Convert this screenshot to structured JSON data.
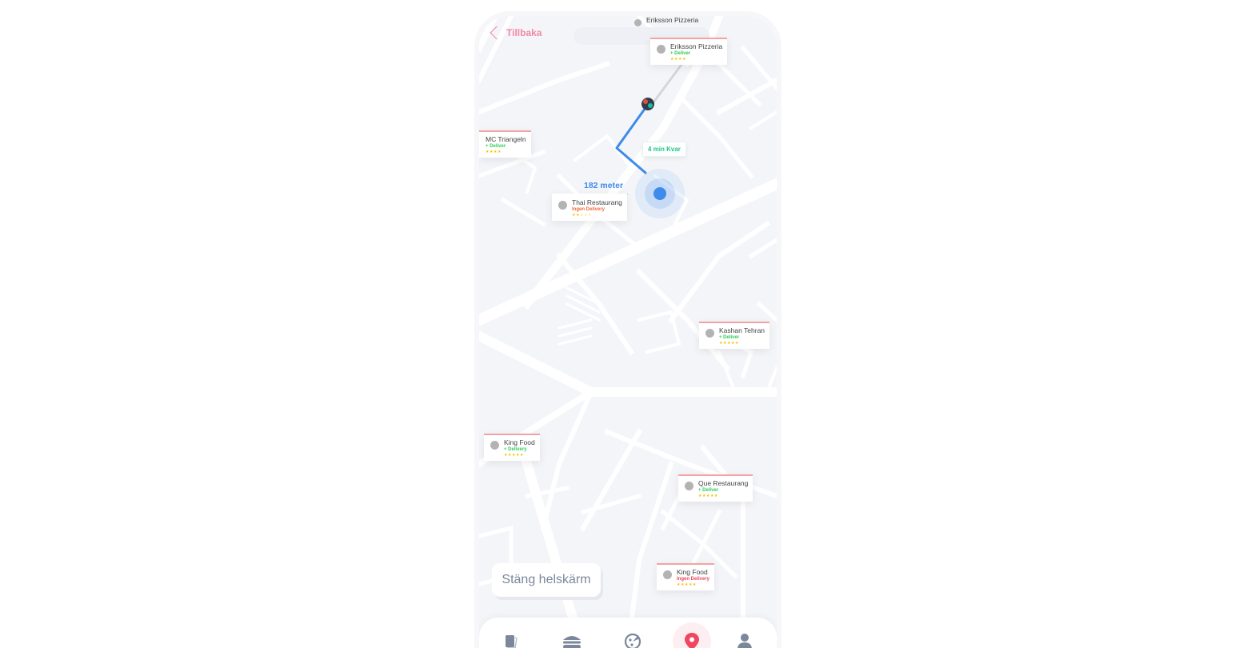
{
  "header": {
    "back_label": "Tillbaka"
  },
  "map": {
    "eta_label": "4 min Kvar",
    "distance_label": "182 meter",
    "route_color": "#3d8bea",
    "user_location_color": "#3d8bea"
  },
  "markers": [
    {
      "name": "Eriksson Pizzeria",
      "status": "",
      "rating": ""
    },
    {
      "name": "Eriksson Pizzeria",
      "status": "+ Deliver",
      "rating": "★★★★"
    },
    {
      "name": "MC Triangeln",
      "status": "+ Deliver",
      "rating": "★★★★"
    },
    {
      "name": "Thai Restaurang",
      "status": "Ingen Delivery",
      "rating": "★★☆☆☆"
    },
    {
      "name": "Kashan Tehran",
      "status": "+ Deliver",
      "rating": "★★★★★"
    },
    {
      "name": "King Food",
      "status": "+ Delivery",
      "rating": "★★★★★"
    },
    {
      "name": "Que Restaurang",
      "status": "+ Deliver",
      "rating": "★★★★★"
    },
    {
      "name": "King Food",
      "status": "Ingen Delivery",
      "rating": "★★★★★"
    }
  ],
  "actions": {
    "close_fullscreen": "Stäng helskärm"
  },
  "tabbar": {
    "tabs": [
      {
        "icon": "book-icon",
        "active": false
      },
      {
        "icon": "burger-icon",
        "active": false
      },
      {
        "icon": "pizza-icon",
        "active": false
      },
      {
        "icon": "map-pin-icon",
        "active": true
      },
      {
        "icon": "user-icon",
        "active": false
      }
    ],
    "active_color": "#f0465f",
    "icon_color": "#7c879b"
  }
}
